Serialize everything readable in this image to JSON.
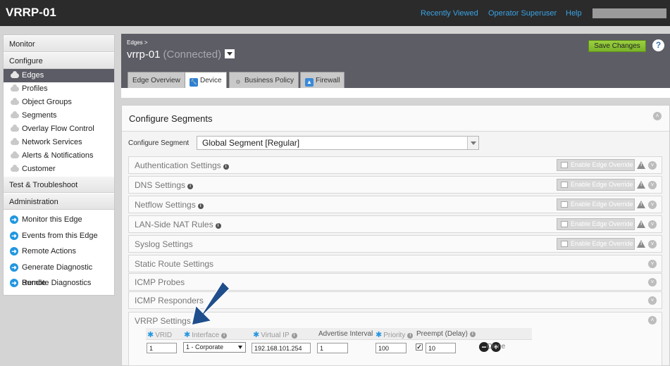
{
  "app": {
    "title": "VRRP-01"
  },
  "topnav": {
    "recently_viewed": "Recently Viewed",
    "user": "Operator Superuser",
    "help": "Help"
  },
  "sidebar": {
    "monitor": "Monitor",
    "configure": "Configure",
    "configure_items": [
      {
        "label": "Edges",
        "icon": "cloud-icon",
        "active": true
      },
      {
        "label": "Profiles",
        "icon": "cloud-icon"
      },
      {
        "label": "Object Groups",
        "icon": "cloud-icon"
      },
      {
        "label": "Segments",
        "icon": "cloud-icon"
      },
      {
        "label": "Overlay Flow Control",
        "icon": "cloud-icon"
      },
      {
        "label": "Network Services",
        "icon": "cloud-icon"
      },
      {
        "label": "Alerts & Notifications",
        "icon": "cloud-icon"
      },
      {
        "label": "Customer",
        "icon": "cloud-icon"
      }
    ],
    "test_troubleshoot": "Test & Troubleshoot",
    "administration": "Administration",
    "admin_items": [
      {
        "label": "Monitor this Edge",
        "icon": "arrow-right-circle-icon"
      },
      {
        "label": "Events from this Edge",
        "icon": "arrow-right-circle-icon"
      },
      {
        "label": "Remote Actions",
        "icon": "arrow-right-circle-icon"
      },
      {
        "label": "Generate Diagnostic Bundle",
        "icon": "arrow-right-circle-icon"
      },
      {
        "label": "Remote Diagnostics",
        "icon": "arrow-right-circle-icon"
      }
    ]
  },
  "header": {
    "breadcrumb": "Edges",
    "edge_name": "vrrp-01",
    "edge_status": "(Connected)",
    "save_label": "Save Changes",
    "help_label": "?"
  },
  "tabs": [
    {
      "label": "Edge Overview",
      "icon": ""
    },
    {
      "label": "Device",
      "icon": "wrench-icon",
      "active": true
    },
    {
      "label": "Business Policy",
      "icon": "ribbon-icon"
    },
    {
      "label": "Firewall",
      "icon": "flame-icon"
    }
  ],
  "panel": {
    "title": "Configure Segments",
    "segment_label": "Configure Segment",
    "segment_value": "Global Segment [Regular]",
    "override_label": "Enable Edge Override",
    "settings": [
      {
        "label": "Authentication Settings",
        "info": true,
        "override": true
      },
      {
        "label": "DNS Settings",
        "info": true,
        "override": true
      },
      {
        "label": "Netflow Settings",
        "info": true,
        "override": true
      },
      {
        "label": "LAN-Side NAT Rules",
        "info": true,
        "override": true
      },
      {
        "label": "Syslog Settings",
        "info": false,
        "override": true
      },
      {
        "label": "Static Route Settings",
        "info": false,
        "override": false
      },
      {
        "label": "ICMP Probes",
        "info": false,
        "override": false
      },
      {
        "label": "ICMP Responders",
        "info": false,
        "override": false
      }
    ]
  },
  "vrrp": {
    "title": "VRRP Settings",
    "headers": {
      "vrid": "VRID",
      "interface": "Interface",
      "virtual_ip": "Virtual IP",
      "advertise_interval": "Advertise Interval",
      "priority": "Priority",
      "preempt": "Preempt (Delay)"
    },
    "row": {
      "vrid": "1",
      "interface": "1 - Corporate",
      "virtual_ip": "192.168.101.254",
      "advertise_interval": "1",
      "priority": "100",
      "preempt_checked": true,
      "preempt_delay": "10"
    },
    "clone_label": "Clone",
    "minus": "−",
    "plus": "+"
  },
  "colors": {
    "accent_blue": "#2196e0",
    "header_gray": "#5d5d66",
    "save_green": "#8bc34a",
    "callout_arrow": "#1f4e8c"
  }
}
